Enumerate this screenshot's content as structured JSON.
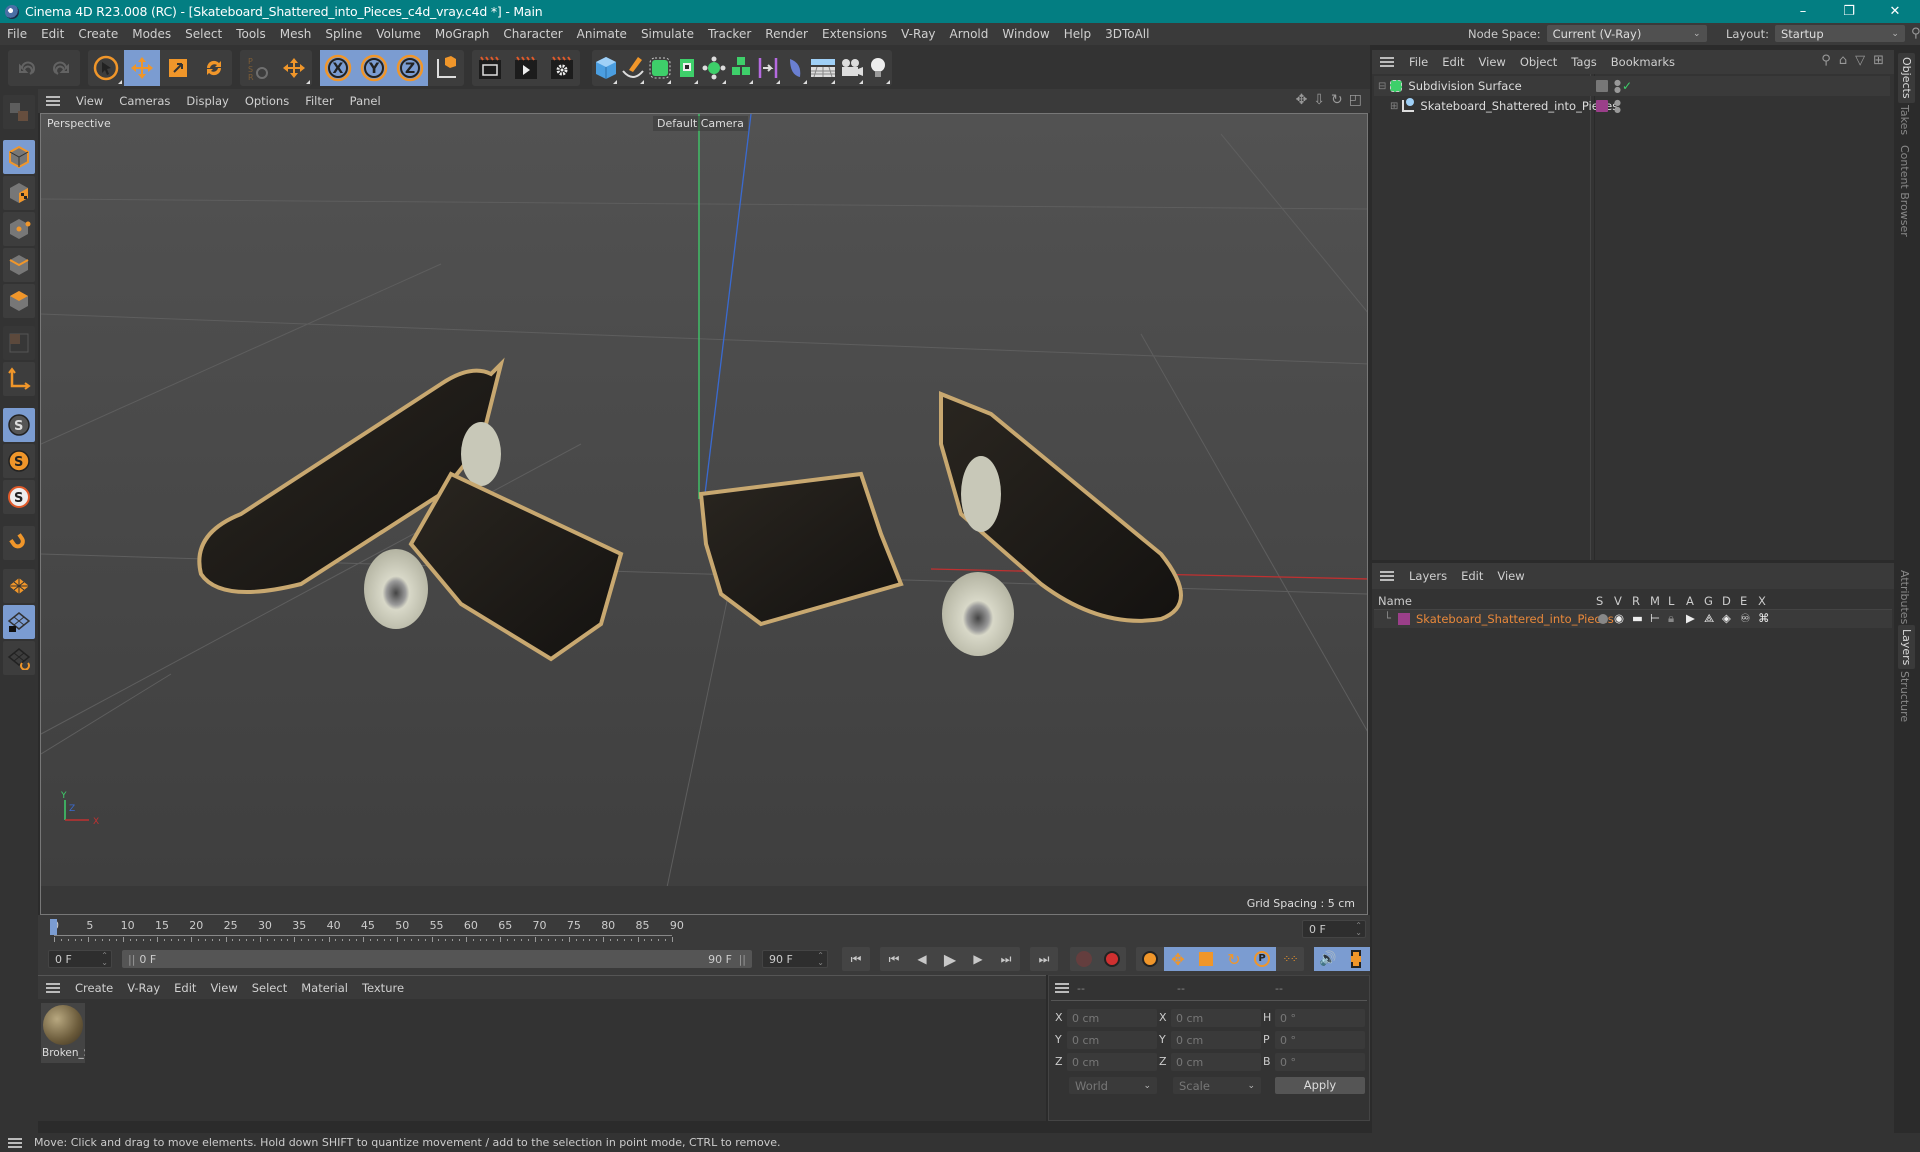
{
  "window": {
    "title": "Cinema 4D R23.008 (RC) - [Skateboard_Shattered_into_Pieces_c4d_vray.c4d *] - Main",
    "controls": {
      "minimize": "–",
      "restore": "❐",
      "close": "✕"
    }
  },
  "menubar": {
    "items": [
      "File",
      "Edit",
      "Create",
      "Modes",
      "Select",
      "Tools",
      "Mesh",
      "Spline",
      "Volume",
      "MoGraph",
      "Character",
      "Animate",
      "Simulate",
      "Tracker",
      "Render",
      "Extensions",
      "V-Ray",
      "Arnold",
      "Window",
      "Help",
      "3DToAll"
    ],
    "node_space_label": "Node Space:",
    "node_space_value": "Current (V-Ray)",
    "layout_label": "Layout:",
    "layout_value": "Startup"
  },
  "toolbar": {
    "groups": [
      {
        "name": "history",
        "icons": [
          "undo-icon",
          "redo-icon"
        ]
      },
      {
        "name": "tools",
        "icons": [
          "live-selection-icon",
          "move-icon",
          "scale-icon",
          "rotate-icon"
        ]
      },
      {
        "name": "psr",
        "icons": [
          "psr-reset-icon",
          "transform-icon"
        ]
      },
      {
        "name": "axis",
        "icons": [
          "x-axis-icon",
          "y-axis-icon",
          "z-axis-icon",
          "coordinate-system-icon"
        ]
      },
      {
        "name": "render",
        "icons": [
          "render-view-icon",
          "render-picture-viewer-icon",
          "render-settings-icon"
        ]
      },
      {
        "name": "objects",
        "icons": [
          "cube-icon",
          "pen-icon",
          "subdivision-icon",
          "extrude-icon",
          "cloner-icon",
          "mograph-icon",
          "deformer-icon",
          "field-icon",
          "floor-icon",
          "camera-icon",
          "light-icon"
        ]
      }
    ]
  },
  "left_tools": [
    "make-editable-icon",
    "model-mode-icon",
    "texture-mode-icon",
    "point-mode-icon",
    "edge-mode-icon",
    "polygon-mode-icon",
    "uv-mode-icon",
    "axis-mode-icon",
    "snap-icon",
    "snap-settings-icon",
    "quantize-icon",
    "magnet-icon",
    "workplane-icon",
    "locked-workplane-icon",
    "align-workplane-icon"
  ],
  "viewport": {
    "menu": [
      "View",
      "Cameras",
      "Display",
      "Options",
      "Filter",
      "Panel"
    ],
    "label": "Perspective",
    "camera": "Default Camera",
    "grid_spacing": "Grid Spacing : 5 cm",
    "nav_icons": [
      "move-view-icon",
      "dolly-icon",
      "orbit-icon",
      "maximize-icon"
    ],
    "axis_labels": {
      "x": "X",
      "y": "Y",
      "z": "Z"
    }
  },
  "timeline": {
    "ticks": [
      "0",
      "5",
      "10",
      "15",
      "20",
      "25",
      "30",
      "35",
      "40",
      "45",
      "50",
      "55",
      "60",
      "65",
      "70",
      "75",
      "80",
      "85",
      "90"
    ],
    "current_frame": "0 F",
    "start_field": "0 F",
    "range_start": "0 F",
    "range_end": "90 F",
    "end_field": "90 F",
    "current_right": "0 F"
  },
  "materials": {
    "menu": [
      "Create",
      "V-Ray",
      "Edit",
      "View",
      "Select",
      "Material",
      "Texture"
    ],
    "items": [
      {
        "name": "Broken_S"
      }
    ]
  },
  "coordinates": {
    "headers": [
      "--",
      "--",
      "--"
    ],
    "rows": [
      {
        "l1": "X",
        "v1": "0 cm",
        "l2": "X",
        "v2": "0 cm",
        "l3": "H",
        "v3": "0 °"
      },
      {
        "l1": "Y",
        "v1": "0 cm",
        "l2": "Y",
        "v2": "0 cm",
        "l3": "P",
        "v3": "0 °"
      },
      {
        "l1": "Z",
        "v1": "0 cm",
        "l2": "Z",
        "v2": "0 cm",
        "l3": "B",
        "v3": "0 °"
      }
    ],
    "mode": "World",
    "transform": "Scale",
    "apply": "Apply"
  },
  "objects_panel": {
    "menu": [
      "File",
      "Edit",
      "View",
      "Object",
      "Tags",
      "Bookmarks"
    ],
    "tree": [
      {
        "name": "Subdivision Surface",
        "level": 0,
        "color": "#888888"
      },
      {
        "name": "Skateboard_Shattered_into_Pieces",
        "level": 1,
        "color": "#9b3f8a"
      }
    ]
  },
  "layers_panel": {
    "menu": [
      "Layers",
      "Edit",
      "View"
    ],
    "columns": [
      "Name",
      "S",
      "V",
      "R",
      "M",
      "L",
      "A",
      "G",
      "D",
      "E",
      "X"
    ],
    "rows": [
      {
        "name": "Skateboard_Shattered_into_Pieces",
        "color": "#9b3f8a",
        "text_color": "#e8883a"
      }
    ]
  },
  "right_tabs": {
    "top": [
      "Objects",
      "Takes",
      "Content Browser"
    ],
    "bottom": [
      "Attributes",
      "Layers",
      "Structure"
    ]
  },
  "status": {
    "text": "Move: Click and drag to move elements. Hold down SHIFT to quantize movement / add to the selection in point mode, CTRL to remove."
  },
  "colors": {
    "titlebar": "#037e82",
    "accent_active": "#7b9cd1",
    "orange": "#f0962a",
    "layer_text": "#e8883a"
  }
}
